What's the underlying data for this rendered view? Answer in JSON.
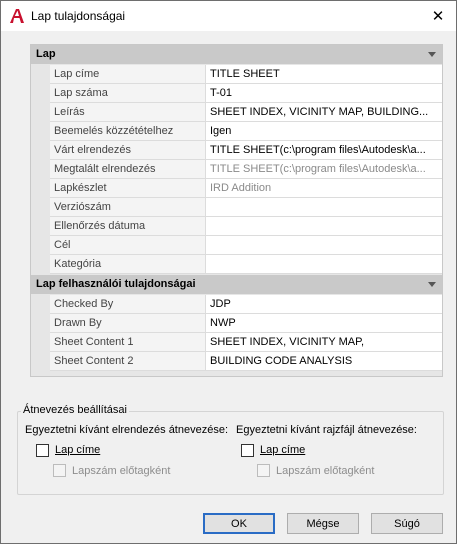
{
  "window": {
    "title": "Lap tulajdonságai",
    "close_glyph": "✕",
    "app_icon": "autocad-icon",
    "icon_color": "#c8102e"
  },
  "grid": {
    "categories": [
      {
        "label": "Lap",
        "rows": [
          {
            "name": "Lap címe",
            "value": "TITLE SHEET",
            "disabled": false
          },
          {
            "name": "Lap száma",
            "value": "T-01",
            "disabled": false
          },
          {
            "name": "Leírás",
            "value": "SHEET INDEX, VICINITY MAP, BUILDING...",
            "disabled": false
          },
          {
            "name": "Beemelés közzétételhez",
            "value": "Igen",
            "disabled": false
          },
          {
            "name": "Várt elrendezés",
            "value": "TITLE SHEET(c:\\program files\\Autodesk\\a...",
            "disabled": false
          },
          {
            "name": "Megtalált elrendezés",
            "value": "TITLE SHEET(c:\\program files\\Autodesk\\a...",
            "disabled": true
          },
          {
            "name": "Lapkészlet",
            "value": "IRD Addition",
            "disabled": true
          },
          {
            "name": "Verziószám",
            "value": "",
            "disabled": false
          },
          {
            "name": "Ellenőrzés dátuma",
            "value": "",
            "disabled": false
          },
          {
            "name": "Cél",
            "value": "",
            "disabled": false
          },
          {
            "name": "Kategória",
            "value": "",
            "disabled": false
          }
        ]
      },
      {
        "label": "Lap felhasználói tulajdonságai",
        "rows": [
          {
            "name": "Checked By",
            "value": "JDP",
            "disabled": false
          },
          {
            "name": "Drawn By",
            "value": "NWP",
            "disabled": false
          },
          {
            "name": "Sheet Content 1",
            "value": "SHEET INDEX, VICINITY MAP,",
            "disabled": false
          },
          {
            "name": "Sheet Content 2",
            "value": "BUILDING CODE ANALYSIS",
            "disabled": false
          }
        ]
      }
    ]
  },
  "rename": {
    "group_label": "Átnevezés beállításai",
    "layout_heading": "Egyeztetni kívánt elrendezés átnevezése:",
    "file_heading": "Egyeztetni kívánt rajzfájl átnevezése:",
    "layout_title_cb": {
      "label": "Lap címe",
      "checked": false
    },
    "layout_prefix_cb": {
      "label": "Lapszám előtagként",
      "checked": false
    },
    "file_title_cb": {
      "label": "Lap címe",
      "checked": false
    },
    "file_prefix_cb": {
      "label": "Lapszám előtagként",
      "checked": false
    }
  },
  "buttons": {
    "ok": "OK",
    "cancel": "Mégse",
    "help": "Súgó"
  }
}
